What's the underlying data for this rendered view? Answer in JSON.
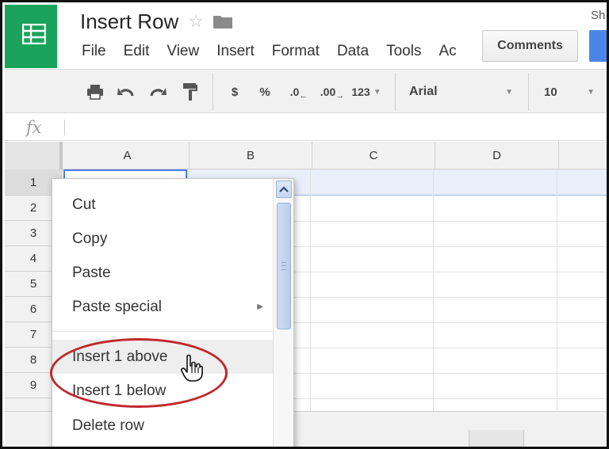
{
  "app": {
    "doc_title": "Insert Row",
    "share_label": "Sh",
    "comments_label": "Comments"
  },
  "menubar": [
    "File",
    "Edit",
    "View",
    "Insert",
    "Format",
    "Data",
    "Tools",
    "Ac"
  ],
  "toolbar": {
    "currency": "$",
    "percent": "%",
    "dec_decrease": ".0",
    "dec_increase": ".00",
    "format_123": "123",
    "font_name": "Arial",
    "font_size": "10"
  },
  "formula_bar": {
    "fx_label": "fx",
    "value": ""
  },
  "grid": {
    "columns": [
      "A",
      "B",
      "C",
      "D"
    ],
    "rows": [
      "1",
      "2",
      "3",
      "4",
      "5",
      "6",
      "7",
      "8",
      "9"
    ]
  },
  "context_menu": {
    "items": [
      {
        "label": "Cut"
      },
      {
        "label": "Copy"
      },
      {
        "label": "Paste"
      },
      {
        "label": "Paste special",
        "has_submenu": true
      },
      {
        "label": "Insert 1 above",
        "hover": true
      },
      {
        "label": "Insert 1 below"
      },
      {
        "label": "Delete row"
      }
    ]
  },
  "colors": {
    "logo_green": "#1aa35a",
    "selection_blue": "#4d7ee8",
    "annotation_red": "#c0282d"
  }
}
